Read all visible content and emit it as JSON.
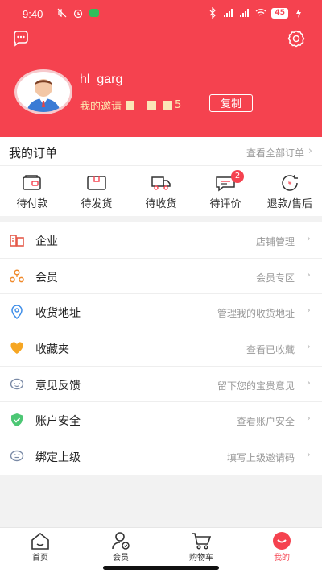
{
  "status_bar": {
    "time": "9:40",
    "battery": "45",
    "left_icons": [
      "mute-icon",
      "alarm-icon",
      "wechat-icon"
    ],
    "right_icons": [
      "bluetooth-icon",
      "signal-icon",
      "signal-icon",
      "wifi-icon",
      "battery-icon",
      "charging-icon"
    ]
  },
  "profile": {
    "username": "hl_garg",
    "invite_label": "我的邀请",
    "invite_code_visible_tail": "5",
    "copy_label": "复制"
  },
  "orders": {
    "title": "我的订单",
    "view_all": "查看全部订单",
    "items": [
      {
        "label": "待付款",
        "icon": "wallet-icon"
      },
      {
        "label": "待发货",
        "icon": "package-icon"
      },
      {
        "label": "待收货",
        "icon": "truck-icon"
      },
      {
        "label": "待评价",
        "icon": "comment-icon",
        "badge": "2"
      },
      {
        "label": "退款/售后",
        "icon": "refund-icon"
      }
    ]
  },
  "menu": [
    {
      "title": "企业",
      "hint": "店铺管理",
      "icon": "enterprise-icon"
    },
    {
      "title": "会员",
      "hint": "会员专区",
      "icon": "member-icon"
    },
    {
      "title": "收货地址",
      "hint": "管理我的收货地址",
      "icon": "location-icon"
    },
    {
      "title": "收藏夹",
      "hint": "查看已收藏",
      "icon": "heart-icon"
    },
    {
      "title": "意见反馈",
      "hint": "留下您的宝贵意见",
      "icon": "feedback-icon"
    },
    {
      "title": "账户安全",
      "hint": "查看账户安全",
      "icon": "shield-icon"
    },
    {
      "title": "绑定上级",
      "hint": "填写上级邀请码",
      "icon": "bind-icon"
    }
  ],
  "tabbar": [
    {
      "label": "首页",
      "icon": "home-icon"
    },
    {
      "label": "会员",
      "icon": "member-tab-icon"
    },
    {
      "label": "购物车",
      "icon": "cart-icon"
    },
    {
      "label": "我的",
      "icon": "mine-icon",
      "active": true
    }
  ],
  "colors": {
    "brand": "#f5424f",
    "muted": "#999999",
    "divider": "#eeeeee"
  }
}
